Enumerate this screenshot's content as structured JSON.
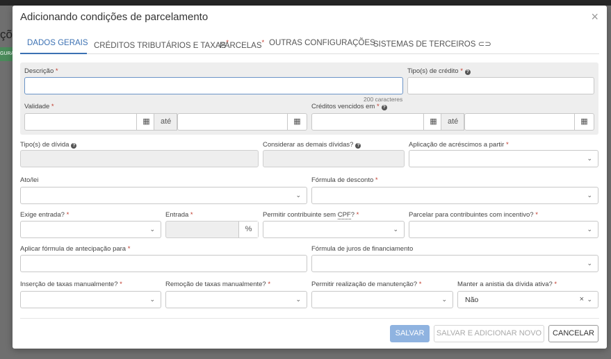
{
  "background": {
    "title": "ções",
    "chip": "GURA"
  },
  "modal": {
    "title": "Adicionando condições de parcelamento",
    "close": "×"
  },
  "tabs": [
    {
      "label": "DADOS GERAIS",
      "required": "",
      "active": true
    },
    {
      "label": "CRÉDITOS TRIBUTÁRIOS E TAXAS",
      "required": "*"
    },
    {
      "label": "PARCELAS",
      "required": "*"
    },
    {
      "label": "OUTRAS CONFIGURAÇÕES",
      "required": ""
    },
    {
      "label": "SISTEMAS DE TERCEIROS",
      "required": ""
    }
  ],
  "form": {
    "descricao": {
      "label": "Descrição",
      "value": "",
      "counter": "200 caracteres"
    },
    "tipos_credito": {
      "label": "Tipo(s) de crédito"
    },
    "validade": {
      "label": "Validade",
      "ate": "até"
    },
    "creditos_vencidos": {
      "label": "Créditos vencidos em",
      "ate": "até"
    },
    "tipos_divida": {
      "label": "Tipo(s) de dívida"
    },
    "considerar": {
      "label": "Considerar as demais dívidas?"
    },
    "aplicacao_acrescimos": {
      "label": "Aplicação de acréscimos a partir"
    },
    "ato_lei": {
      "label": "Ato/lei"
    },
    "formula_desconto": {
      "label": "Fórmula de desconto"
    },
    "exige_entrada": {
      "label": "Exige entrada?"
    },
    "entrada": {
      "label": "Entrada",
      "unit": "%"
    },
    "permitir_sem_cpf": {
      "label_prefix": "Permitir contribuinte sem ",
      "label_abbr": "CPF",
      "label_suffix": "?"
    },
    "parcelar_incentivo": {
      "label": "Parcelar para contribuintes com incentivo?"
    },
    "formula_antecipacao": {
      "label": "Aplicar fórmula de antecipação para"
    },
    "formula_juros": {
      "label": "Fórmula de juros de financiamento"
    },
    "insercao_taxas": {
      "label": "Inserção de taxas manualmente?"
    },
    "remocao_taxas": {
      "label": "Remoção de taxas manualmente?"
    },
    "permitir_manutencao": {
      "label": "Permitir realização de manutenção?"
    },
    "manter_anistia": {
      "label": "Manter a anistia da dívida ativa?",
      "value": "Não"
    }
  },
  "footer": {
    "save": "SALVAR",
    "save_add": "SALVAR E ADICIONAR NOVO",
    "cancel": "CANCELAR"
  },
  "icons": {
    "caret": "⌄",
    "calendar": "▦",
    "help": "?",
    "clear": "×"
  },
  "colors": {
    "accent": "#3b71b3",
    "required": "#c0392b",
    "primary_button": "#8fb3e0"
  }
}
